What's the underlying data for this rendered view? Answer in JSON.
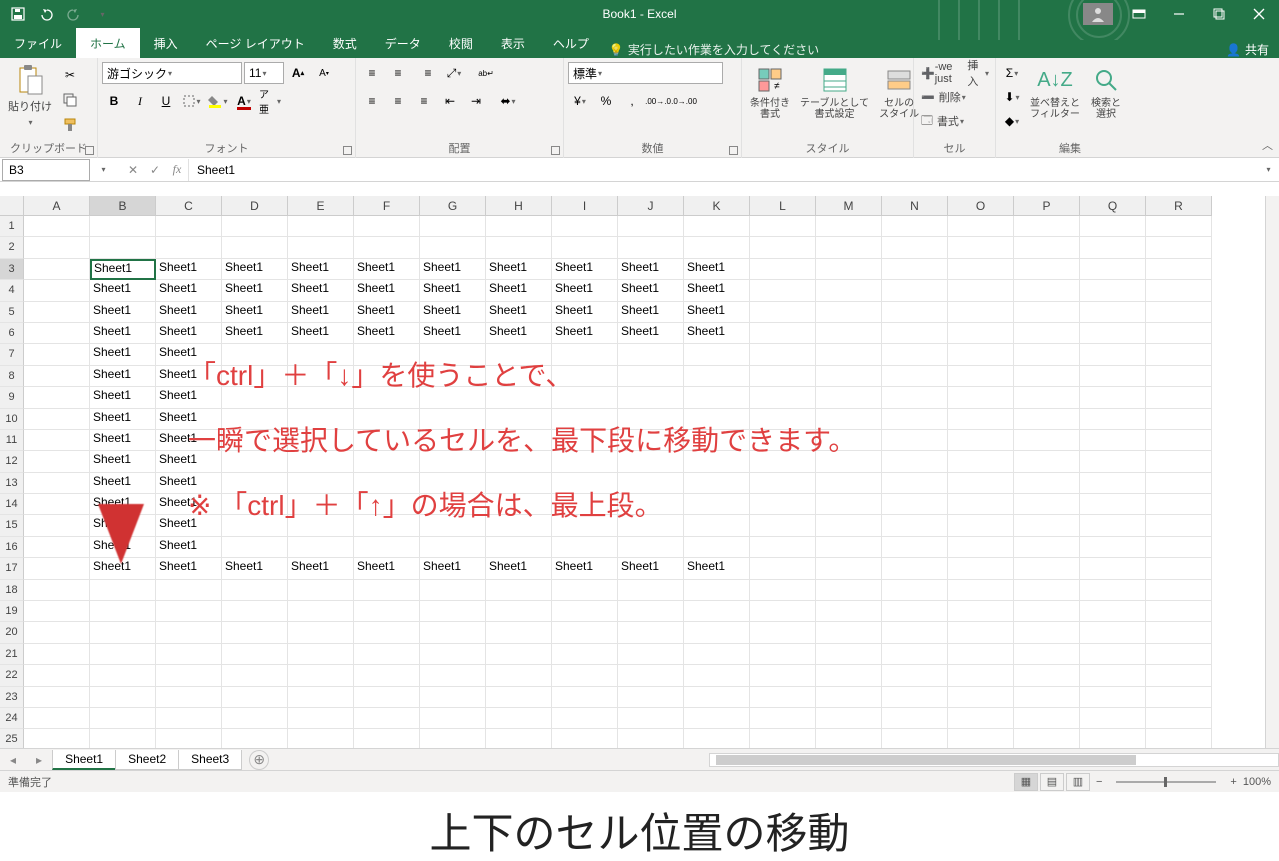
{
  "titlebar": {
    "title": "Book1  -  Excel"
  },
  "tabs": {
    "file": "ファイル",
    "home": "ホーム",
    "insert": "挿入",
    "layout": "ページ レイアウト",
    "formulas": "数式",
    "data": "データ",
    "review": "校閲",
    "view": "表示",
    "help": "ヘルプ",
    "tell_me": "実行したい作業を入力してください",
    "share": "共有"
  },
  "ribbon": {
    "clipboard": {
      "label": "クリップボード",
      "paste": "貼り付け"
    },
    "font": {
      "label": "フォント",
      "name": "游ゴシック",
      "size": "11"
    },
    "align": {
      "label": "配置"
    },
    "number": {
      "label": "数値",
      "format": "標準"
    },
    "style": {
      "label": "スタイル",
      "cond": "条件付き\n書式",
      "table": "テーブルとして\n書式設定",
      "cellstyle": "セルの\nスタイル"
    },
    "cells": {
      "label": "セル",
      "insert": "挿入",
      "delete": "削除",
      "format": "書式"
    },
    "edit": {
      "label": "編集",
      "sort": "並べ替えと\nフィルター",
      "find": "検索と\n選択"
    }
  },
  "formula_bar": {
    "name_box": "B3",
    "value": "Sheet1"
  },
  "grid": {
    "columns": [
      "A",
      "B",
      "C",
      "D",
      "E",
      "F",
      "G",
      "H",
      "I",
      "J",
      "K",
      "L",
      "M",
      "N",
      "O",
      "P",
      "Q",
      "R"
    ],
    "row_count": 25,
    "active_cell": {
      "row": 3,
      "col": "B"
    },
    "data_value": "Sheet1",
    "data_region": {
      "row_start": 3,
      "row_end": 17,
      "cols": [
        "B",
        "C",
        "D",
        "E",
        "F",
        "G",
        "H",
        "I",
        "J",
        "K"
      ]
    },
    "short_rows": {
      "start": 7,
      "end": 16,
      "cols": [
        "B",
        "C"
      ]
    }
  },
  "sheets": {
    "tabs": [
      "Sheet1",
      "Sheet2",
      "Sheet3"
    ],
    "active": 0
  },
  "status": {
    "ready": "準備完了",
    "zoom": "100%"
  },
  "annotation": {
    "line1": "「ctrl」＋「↓」を使うことで、",
    "line2": "一瞬で選択しているセルを、最下段に移動できます。",
    "line3": "※ 「ctrl」＋「↑」の場合は、最上段。",
    "bottom_title": "上下のセル位置の移動"
  },
  "colors": {
    "brand": "#217346",
    "annotation": "#e04040"
  }
}
